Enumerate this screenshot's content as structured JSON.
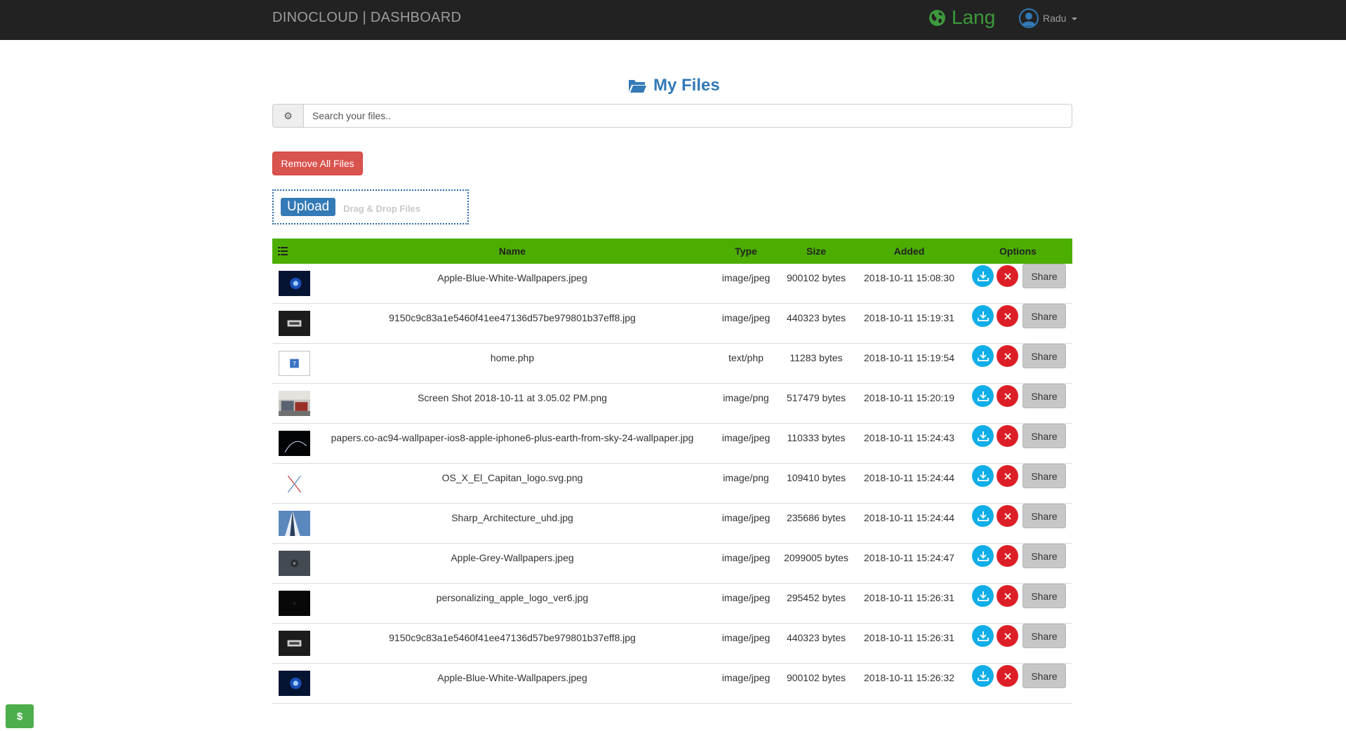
{
  "navbar": {
    "brand": "DINOCLOUD | DASHBOARD",
    "lang_label": "Lang",
    "user_name": "Radu"
  },
  "page": {
    "title": "My Files"
  },
  "search": {
    "placeholder": "Search your files.."
  },
  "actions": {
    "remove_all_label": "Remove All Files",
    "upload_label": "Upload",
    "drag_drop_label": "Drag & Drop Files",
    "share_label": "Share",
    "dollar_label": "$"
  },
  "table": {
    "headers": {
      "name": "Name",
      "type": "Type",
      "size": "Size",
      "added": "Added",
      "options": "Options"
    },
    "rows": [
      {
        "name": "Apple-Blue-White-Wallpapers.jpeg",
        "type": "image/jpeg",
        "size": "900102 bytes",
        "added": "2018-10-11 15:08:30",
        "thumb": "blue-orb"
      },
      {
        "name": "9150c9c83a1e5460f41ee47136d57be979801b37eff8.jpg",
        "type": "image/jpeg",
        "size": "440323 bytes",
        "added": "2018-10-11 15:19:31",
        "thumb": "dark-logo"
      },
      {
        "name": "home.php",
        "type": "text/php",
        "size": "11283 bytes",
        "added": "2018-10-11 15:19:54",
        "thumb": "missing-file"
      },
      {
        "name": "Screen Shot 2018-10-11 at 3.05.02 PM.png",
        "type": "image/png",
        "size": "517479 bytes",
        "added": "2018-10-11 15:20:19",
        "thumb": "photo"
      },
      {
        "name": "papers.co-ac94-wallpaper-ios8-apple-iphone6-plus-earth-from-sky-24-wallpaper.jpg",
        "type": "image/jpeg",
        "size": "110333 bytes",
        "added": "2018-10-11 15:24:43",
        "thumb": "earth-arc"
      },
      {
        "name": "OS_X_El_Capitan_logo.svg.png",
        "type": "image/png",
        "size": "109410 bytes",
        "added": "2018-10-11 15:24:44",
        "thumb": "x-logo"
      },
      {
        "name": "Sharp_Architecture_uhd.jpg",
        "type": "image/jpeg",
        "size": "235686 bytes",
        "added": "2018-10-11 15:24:44",
        "thumb": "architecture"
      },
      {
        "name": "Apple-Grey-Wallpapers.jpeg",
        "type": "image/jpeg",
        "size": "2099005 bytes",
        "added": "2018-10-11 15:24:47",
        "thumb": "grey-orb"
      },
      {
        "name": "personalizing_apple_logo_ver6.jpg",
        "type": "image/jpeg",
        "size": "295452 bytes",
        "added": "2018-10-11 15:26:31",
        "thumb": "black-logo"
      },
      {
        "name": "9150c9c83a1e5460f41ee47136d57be979801b37eff8.jpg",
        "type": "image/jpeg",
        "size": "440323 bytes",
        "added": "2018-10-11 15:26:31",
        "thumb": "dark-logo"
      },
      {
        "name": "Apple-Blue-White-Wallpapers.jpeg",
        "type": "image/jpeg",
        "size": "900102 bytes",
        "added": "2018-10-11 15:26:32",
        "thumb": "blue-orb"
      }
    ]
  },
  "colors": {
    "navbar_bg": "#222222",
    "header_green": "#4cae00",
    "danger": "#d9534f",
    "primary": "#337ab7",
    "download_blue": "#10aee8",
    "delete_red": "#dc1f26"
  }
}
